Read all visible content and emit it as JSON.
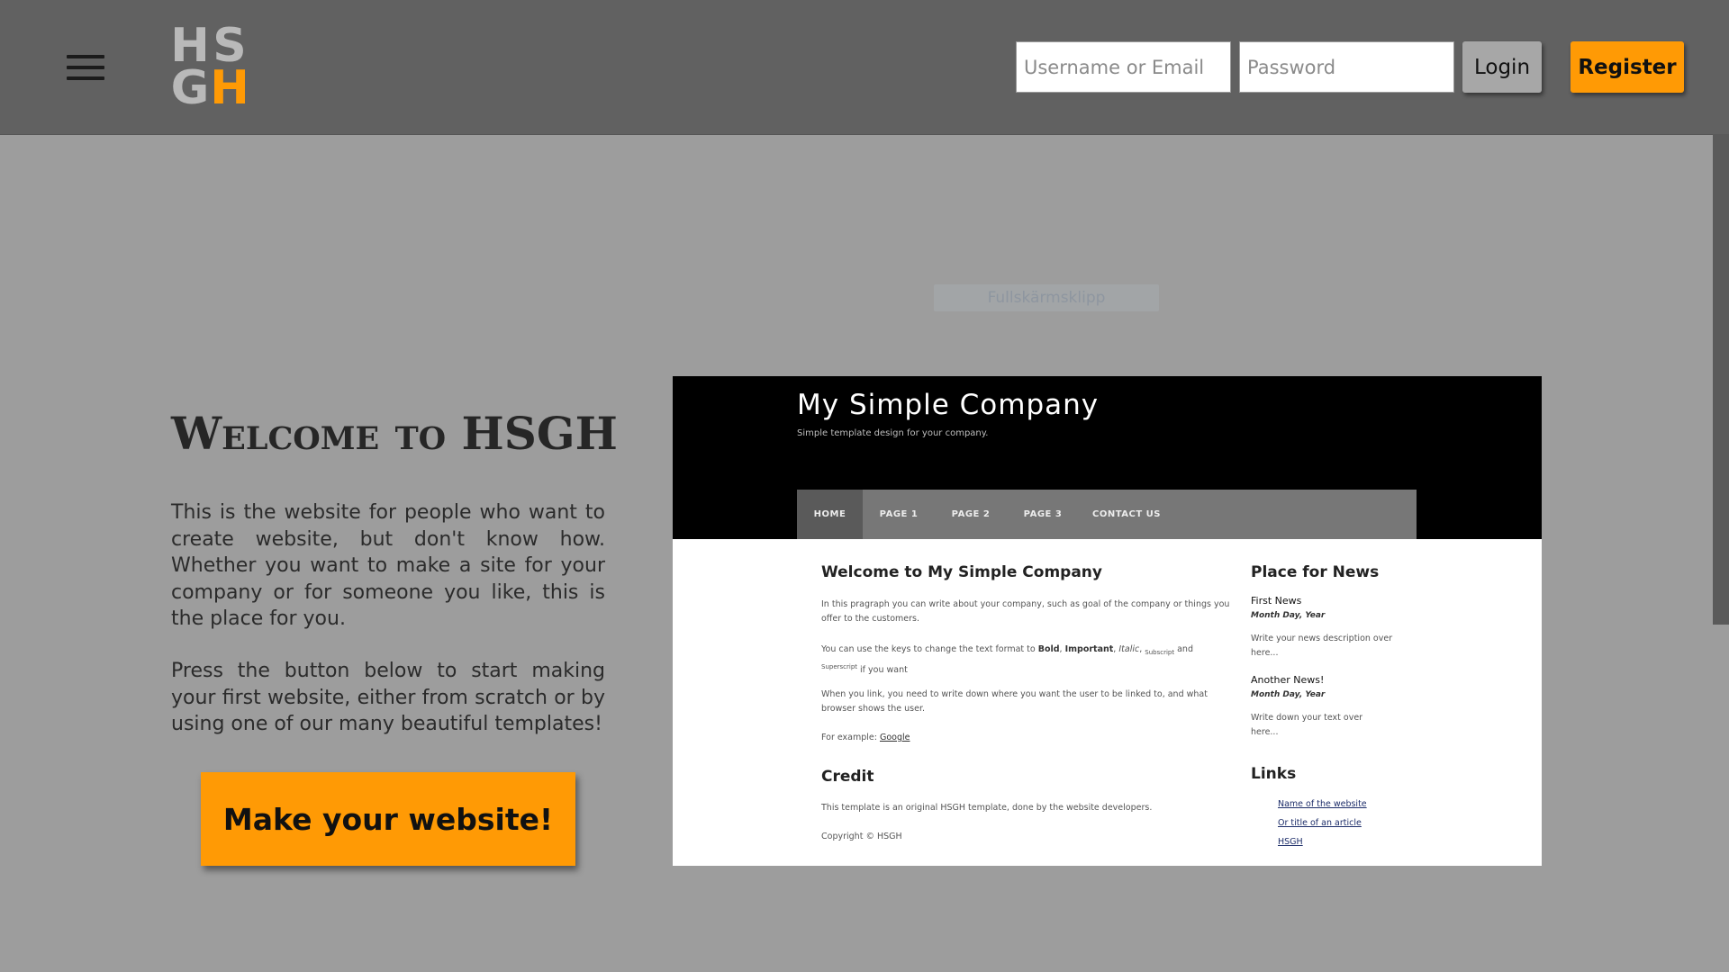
{
  "header": {
    "logo_letters": [
      "H",
      "S",
      "G",
      "H"
    ],
    "username_placeholder": "Username or Email",
    "password_placeholder": "Password",
    "login_label": "Login",
    "register_label": "Register"
  },
  "snip_label": "Fullskärmsklipp",
  "welcome": {
    "title": "Welcome to HSGH",
    "paragraph1": "This is the website for people who want to create website, but don't know how. Whether you want to make a site for your company or for someone you like, this is the place for you.",
    "paragraph2": "Press the button below to start making your first website, either from scratch or by using one of our many beautiful templates!",
    "cta_label": "Make your website!"
  },
  "preview": {
    "site_title": "My Simple Company",
    "tagline": "Simple template design for your company.",
    "nav": [
      "HOME",
      "PAGE 1",
      "PAGE 2",
      "PAGE 3",
      "CONTACT US"
    ],
    "main_heading": "Welcome to My Simple Company",
    "p1": "In this pragraph you can write about your company, such as goal of the company or things you offer to the customers.",
    "p2": {
      "before": "You can use the keys to change the text format to ",
      "bold": "Bold",
      "sep1": ", ",
      "important": "Important",
      "sep2": ", ",
      "italic": "Italic",
      "sep3": ", ",
      "subscript": "Subscript",
      "and": " and ",
      "superscript": "Superscript",
      "after": " if you want"
    },
    "p3": "When you link, you need to write down where you want the user to be linked to, and what browser shows the user.",
    "example_prefix": "For example: ",
    "example_link": "Google",
    "credit_heading": "Credit",
    "credit_text": "This template is an original HSGH template, done by the website developers.",
    "copyright": "Copyright © HSGH",
    "news_heading": "Place for News",
    "news": [
      {
        "title": "First News",
        "date": "Month Day, Year",
        "text": "Write your news description over here..."
      },
      {
        "title": "Another News!",
        "date": "Month Day, Year",
        "text": "Write down your text over here..."
      }
    ],
    "links_heading": "Links",
    "links": [
      "Name of the website",
      "Or title of an article",
      "HSGH"
    ]
  }
}
